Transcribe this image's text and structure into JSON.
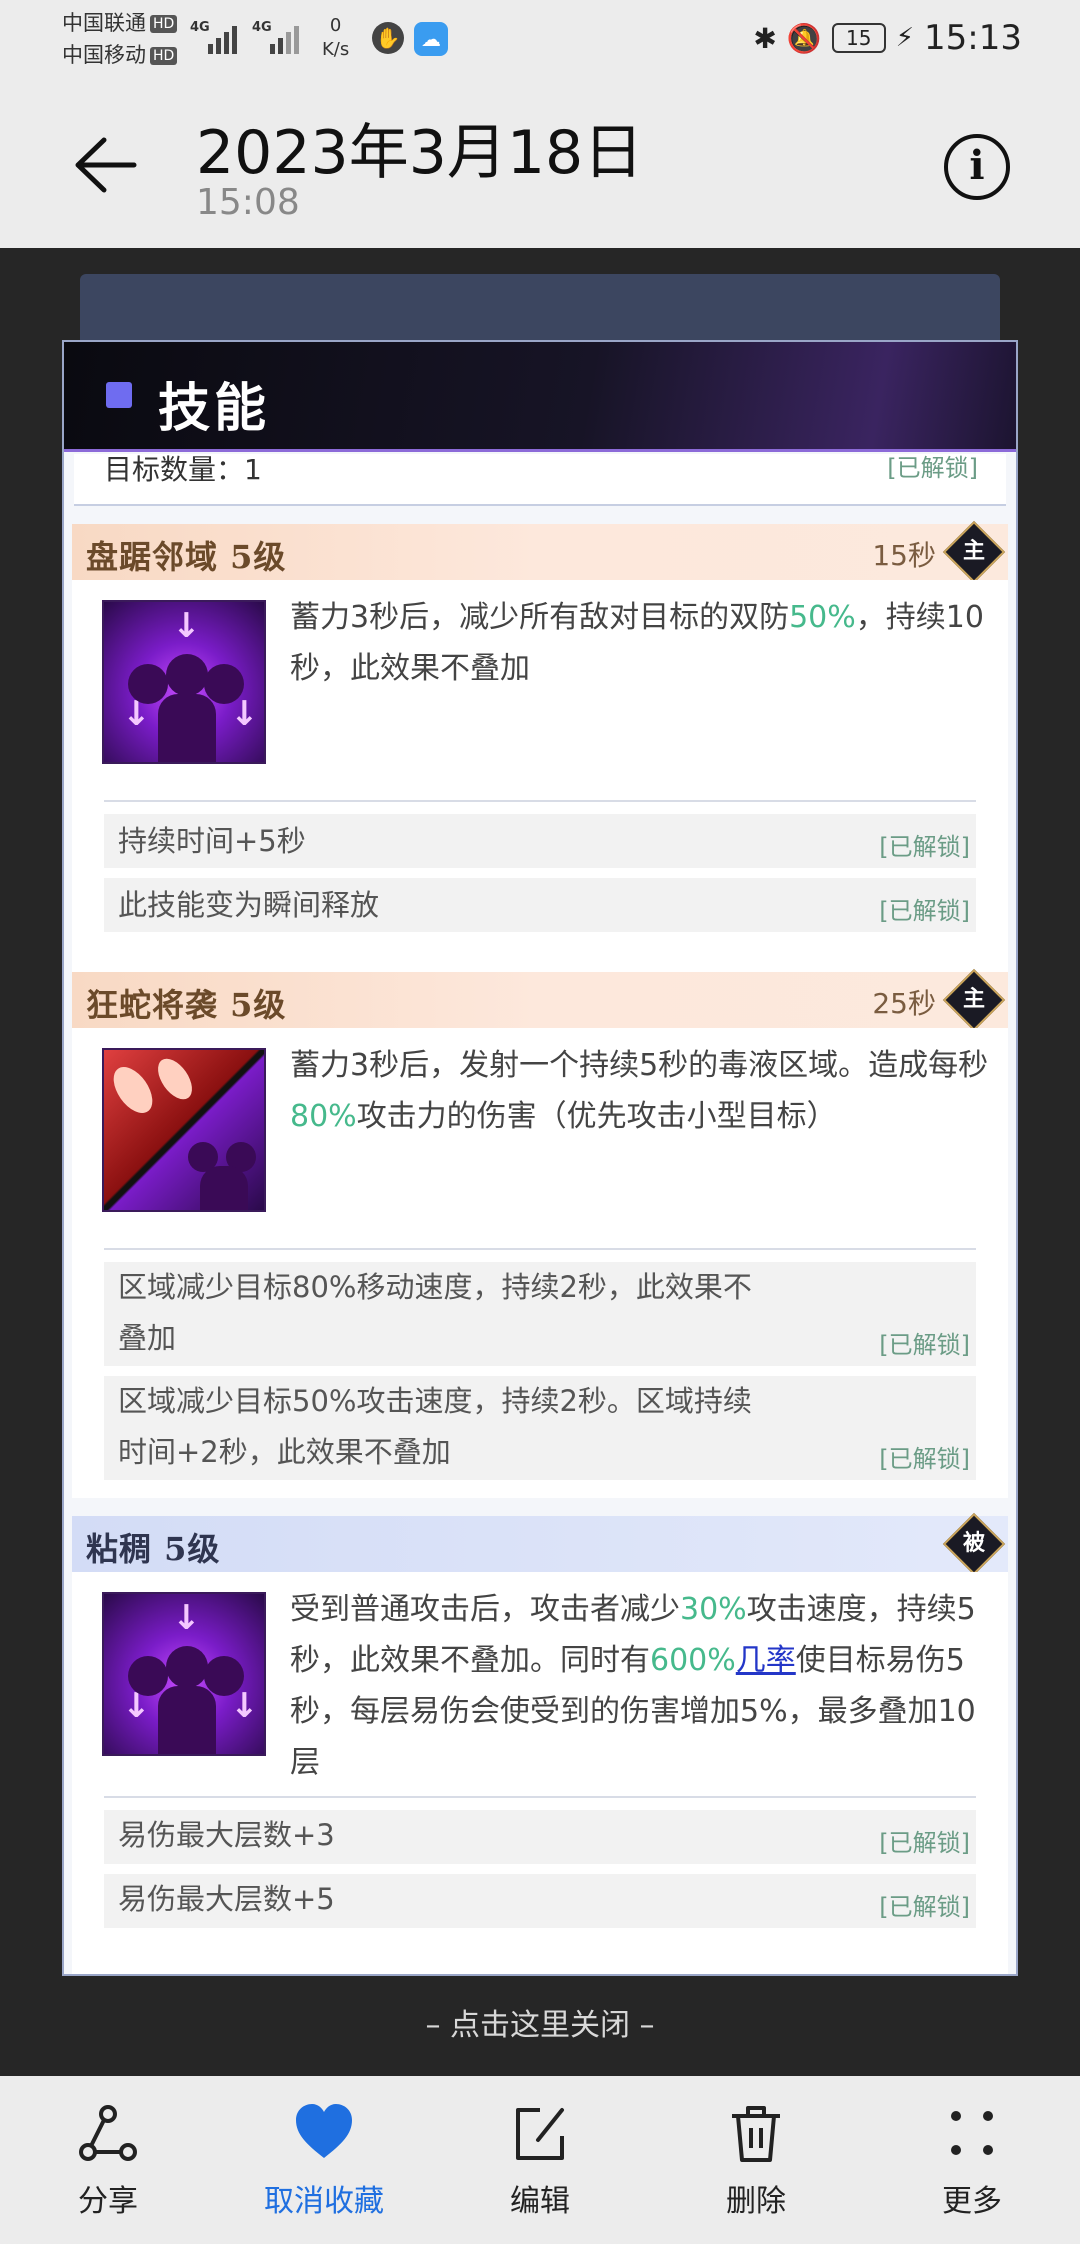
{
  "status_bar": {
    "carrier1": "中国联通",
    "carrier2": "中国移动",
    "hd": "HD",
    "net1": "4G",
    "net2": "4G",
    "speed_value": "0",
    "speed_unit": "K/s",
    "battery": "15",
    "time": "15:13"
  },
  "header": {
    "title": "2023年3月18日",
    "subtitle": "15:08"
  },
  "panel": {
    "title": "技能",
    "cut_row": {
      "text": "目标数量：1",
      "status": "[已解锁]"
    },
    "skills": [
      {
        "name": "盘踞邻域 5级",
        "cooldown": "15秒",
        "badge": "主",
        "desc_parts": [
          "蓄力3秒后，减少所有敌对目标的双防",
          "50%",
          "，持续10秒，此效果不叠加"
        ],
        "upgrades": [
          {
            "text": "持续时间+5秒",
            "status": "[已解锁]"
          },
          {
            "text": "此技能变为瞬间释放",
            "status": "[已解锁]"
          }
        ]
      },
      {
        "name": "狂蛇将袭 5级",
        "cooldown": "25秒",
        "badge": "主",
        "desc_parts": [
          "蓄力3秒后，发射一个持续5秒的毒液区域。造成每秒",
          "80%",
          "攻击力的伤害（优先攻击小型目标）"
        ],
        "upgrades": [
          {
            "text1": "区域减少目标80%移动速度，持续2秒，此效果不",
            "text2": "叠加",
            "status": "[已解锁]"
          },
          {
            "text1": "区域减少目标50%攻击速度，持续2秒。区域持续",
            "text2": "时间+2秒，此效果不叠加",
            "status": "[已解锁]"
          }
        ]
      },
      {
        "name": "粘稠 5级",
        "badge": "被",
        "desc_parts": [
          "受到普通攻击后，攻击者减少",
          "30%",
          "攻击速度，持续5秒，此效果不叠加。同时有",
          "600%",
          "几率",
          "使目标易伤5秒，每层易伤会使受到的伤害增加5%，最多叠加10层"
        ],
        "upgrades": [
          {
            "text": "易伤最大层数+3",
            "status": "[已解锁]"
          },
          {
            "text": "易伤最大层数+5",
            "status": "[已解锁]"
          }
        ]
      }
    ]
  },
  "close_hint": "– 点击这里关闭 –",
  "toolbar": {
    "share": "分享",
    "unfavorite": "取消收藏",
    "edit": "编辑",
    "delete": "删除",
    "more": "更多"
  },
  "colors": {
    "highlight": "#46b98c",
    "favorite": "#1f6fe0",
    "unlocked": "#6b9c86"
  }
}
